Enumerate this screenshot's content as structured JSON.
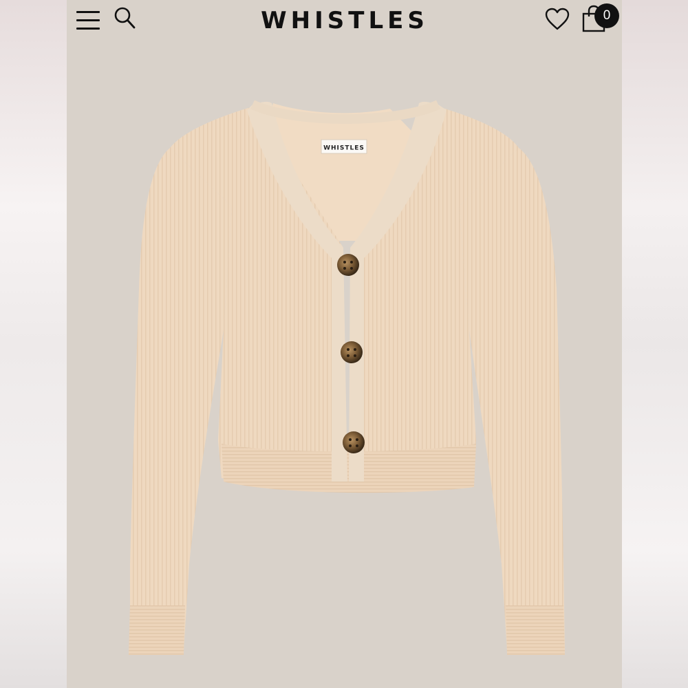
{
  "header": {
    "brand": "WHISTLES",
    "bag_count": "0",
    "icons": [
      "menu-icon",
      "search-icon",
      "heart-icon",
      "shopping-bag-icon"
    ]
  },
  "product": {
    "label_text": "WHISTLES",
    "garment_color": "#efd8bf",
    "button_count": 3
  },
  "colors": {
    "background": "#d9d2ca",
    "icon": "#111111",
    "badge": "#111111"
  }
}
